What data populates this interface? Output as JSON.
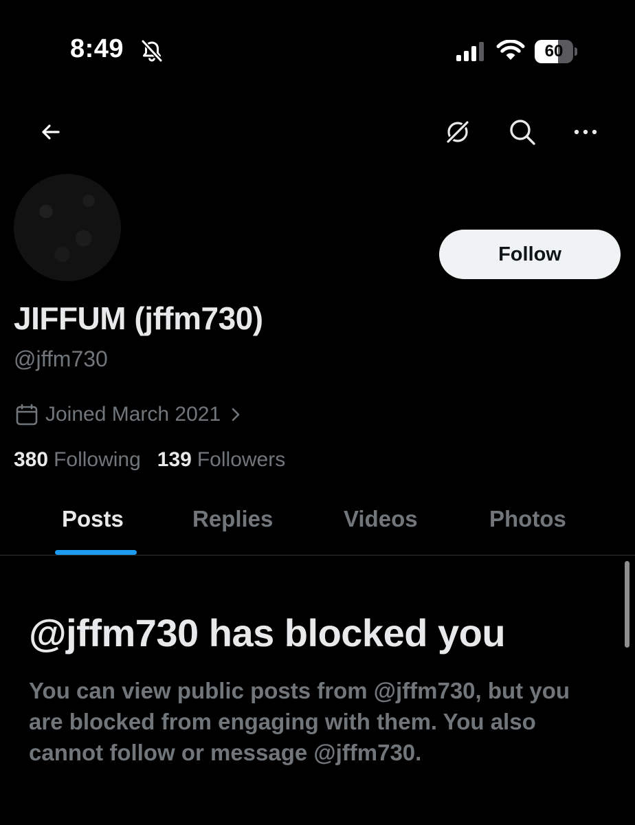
{
  "status_bar": {
    "time": "8:49",
    "battery": "60",
    "battery_level": 0.6,
    "silent_icon": "bell-slash-icon",
    "signal_icon": "cellular-signal-icon",
    "wifi_icon": "wifi-icon"
  },
  "nav": {
    "back_icon": "arrow-left-icon",
    "grok_icon": "grok-icon",
    "search_icon": "search-icon",
    "more_icon": "more-horizontal-icon"
  },
  "profile": {
    "display_name": "JIFFUM (jffm730)",
    "handle": "@jffm730",
    "joined": "Joined March 2021",
    "following_count": "380",
    "following_label": "Following",
    "followers_count": "139",
    "followers_label": "Followers",
    "follow_button": "Follow"
  },
  "tabs": [
    {
      "label": "Posts",
      "active": true
    },
    {
      "label": "Replies",
      "active": false
    },
    {
      "label": "Videos",
      "active": false
    },
    {
      "label": "Photos",
      "active": false
    }
  ],
  "blocked": {
    "title": "@jffm730 has blocked you",
    "description": "You can view public posts from @jffm730, but you are blocked from engaging with them. You also cannot follow or message @jffm730."
  },
  "colors": {
    "background": "#000000",
    "primary_text": "#e7e9ea",
    "secondary_text": "#71767b",
    "accent": "#1d9bf0",
    "follow_button_bg": "#eff3f4"
  }
}
